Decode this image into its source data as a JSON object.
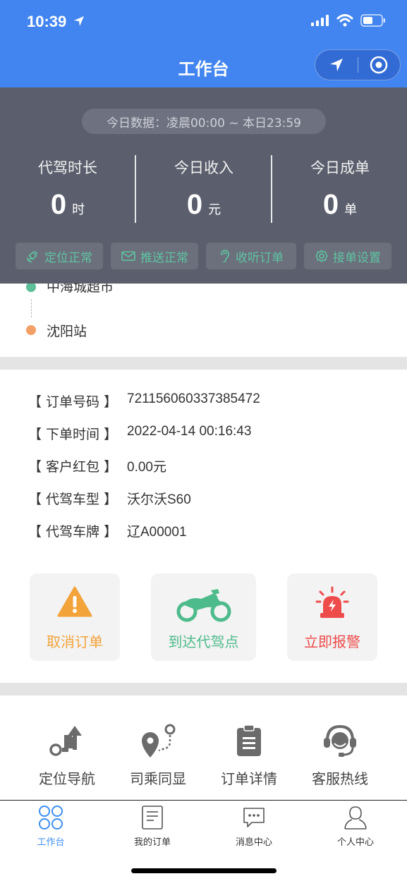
{
  "status_bar": {
    "time": "10:39"
  },
  "nav": {
    "title": "工作台"
  },
  "summary": {
    "date_range": "今日数据：凌晨00:00 ~ 本日23:59",
    "stats": [
      {
        "label": "代驾时长",
        "value": "0",
        "unit": "时"
      },
      {
        "label": "今日收入",
        "value": "0",
        "unit": "元"
      },
      {
        "label": "今日成单",
        "value": "0",
        "unit": "单"
      }
    ],
    "chips": [
      {
        "label": "定位正常",
        "icon": "satellite-icon"
      },
      {
        "label": "推送正常",
        "icon": "mail-icon"
      },
      {
        "label": "收听订单",
        "icon": "ear-icon"
      },
      {
        "label": "接单设置",
        "icon": "gear-icon"
      }
    ]
  },
  "route": {
    "start": "中海城超市",
    "end": "沈阳站",
    "start_color": "#5bbf98",
    "end_color": "#f2a066"
  },
  "order": {
    "rows": [
      {
        "key": "【 订单号码 】",
        "value": "721156060337385472"
      },
      {
        "key": "【 下单时间 】",
        "value": "2022-04-14 00:16:43"
      },
      {
        "key": "【 客户红包 】",
        "value": "0.00元"
      },
      {
        "key": "【 代驾车型 】",
        "value": "沃尔沃S60"
      },
      {
        "key": "【 代驾车牌 】",
        "value": "辽A00001"
      }
    ]
  },
  "actions": [
    {
      "label": "取消订单",
      "icon": "warning-icon",
      "color": "#f2a33a"
    },
    {
      "label": "到达代驾点",
      "icon": "motorcycle-icon",
      "color": "#4dbb8b"
    },
    {
      "label": "立即报警",
      "icon": "alarm-icon",
      "color": "#ee4b4b"
    }
  ],
  "tools": [
    {
      "label": "定位导航",
      "icon": "turn-arrow-icon"
    },
    {
      "label": "司乘同显",
      "icon": "route-pin-icon"
    },
    {
      "label": "订单详情",
      "icon": "clipboard-icon"
    },
    {
      "label": "客服热线",
      "icon": "headset-icon"
    }
  ],
  "tabs": [
    {
      "label": "工作台",
      "icon": "grid-circles-icon",
      "active": true
    },
    {
      "label": "我的订单",
      "icon": "document-icon",
      "active": false
    },
    {
      "label": "消息中心",
      "icon": "chat-bubble-icon",
      "active": false
    },
    {
      "label": "个人中心",
      "icon": "person-icon",
      "active": false
    }
  ],
  "colors": {
    "brand_blue": "#4285f0",
    "panel_gray": "#5b5f6d",
    "chip_green": "#5fc4a2"
  }
}
